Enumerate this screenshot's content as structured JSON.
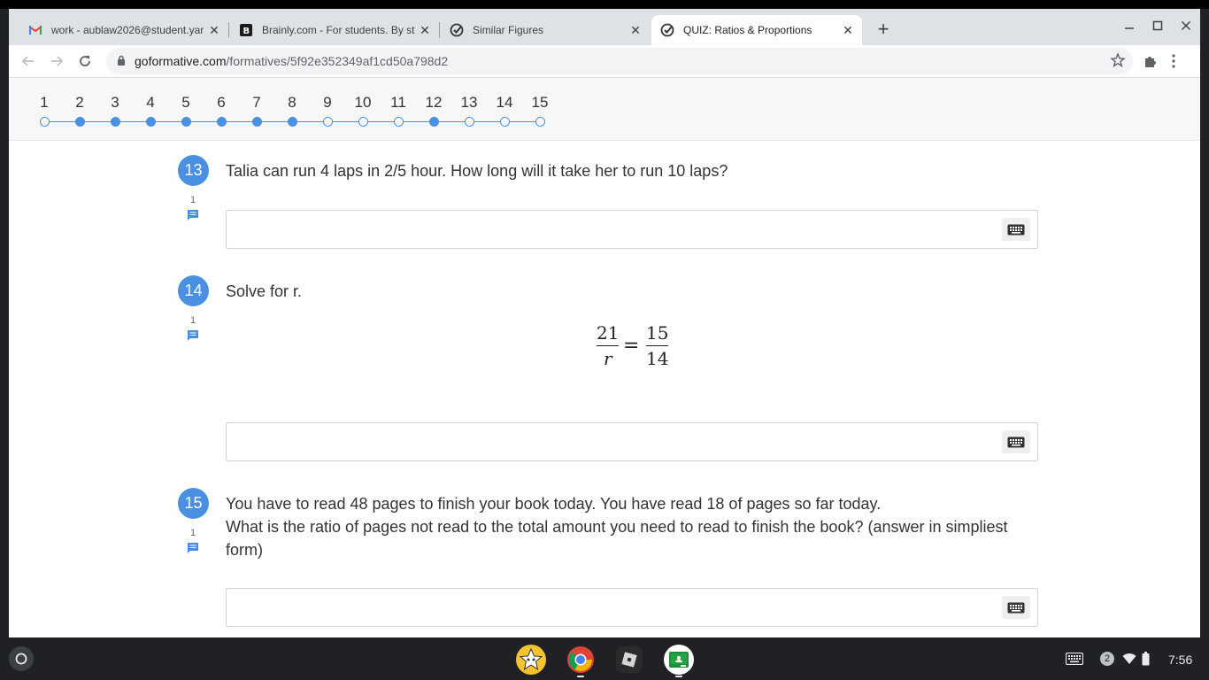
{
  "browser": {
    "tabs": [
      {
        "title": "work - aublaw2026@student.yar",
        "favicon": "gmail-icon",
        "active": false
      },
      {
        "title": "Brainly.com - For students. By st",
        "favicon": "brainly-icon",
        "active": false
      },
      {
        "title": "Similar Figures",
        "favicon": "formative-icon",
        "active": false
      },
      {
        "title": "QUIZ: Ratios & Proportions",
        "favicon": "formative-icon",
        "active": true
      }
    ],
    "url_host": "goformative.com",
    "url_path": "/formatives/5f92e352349af1cd50a798d2"
  },
  "question_nav": {
    "numbers": [
      "1",
      "2",
      "3",
      "4",
      "5",
      "6",
      "7",
      "8",
      "9",
      "10",
      "11",
      "12",
      "13",
      "14",
      "15"
    ],
    "answered": [
      false,
      true,
      true,
      true,
      true,
      true,
      true,
      true,
      false,
      false,
      false,
      true,
      false,
      false,
      false
    ],
    "accent_color": "#4a90e2"
  },
  "questions": [
    {
      "number": "13",
      "points": "1",
      "text": "Talia can run 4 laps in 2/5 hour.  How long will it take her to run 10 laps?",
      "answer": ""
    },
    {
      "number": "14",
      "points": "1",
      "text": "Solve for r.",
      "equation": {
        "left_num": "21",
        "left_den": "r",
        "equals": "=",
        "right_num": "15",
        "right_den": "14"
      },
      "answer": ""
    },
    {
      "number": "15",
      "points": "1",
      "text_line1": "You have to read 48 pages to finish your book today. You have read 18 of pages so far today.",
      "text_line2": "What is the ratio of pages not read to the total amount you need to read to finish the book? (answer in simpliest form)",
      "answer": ""
    }
  ],
  "shelf": {
    "apps": [
      "starface-app-icon",
      "chrome-icon",
      "roblox-icon",
      "google-classroom-icon"
    ],
    "notification_count": "2",
    "time": "7:56"
  }
}
